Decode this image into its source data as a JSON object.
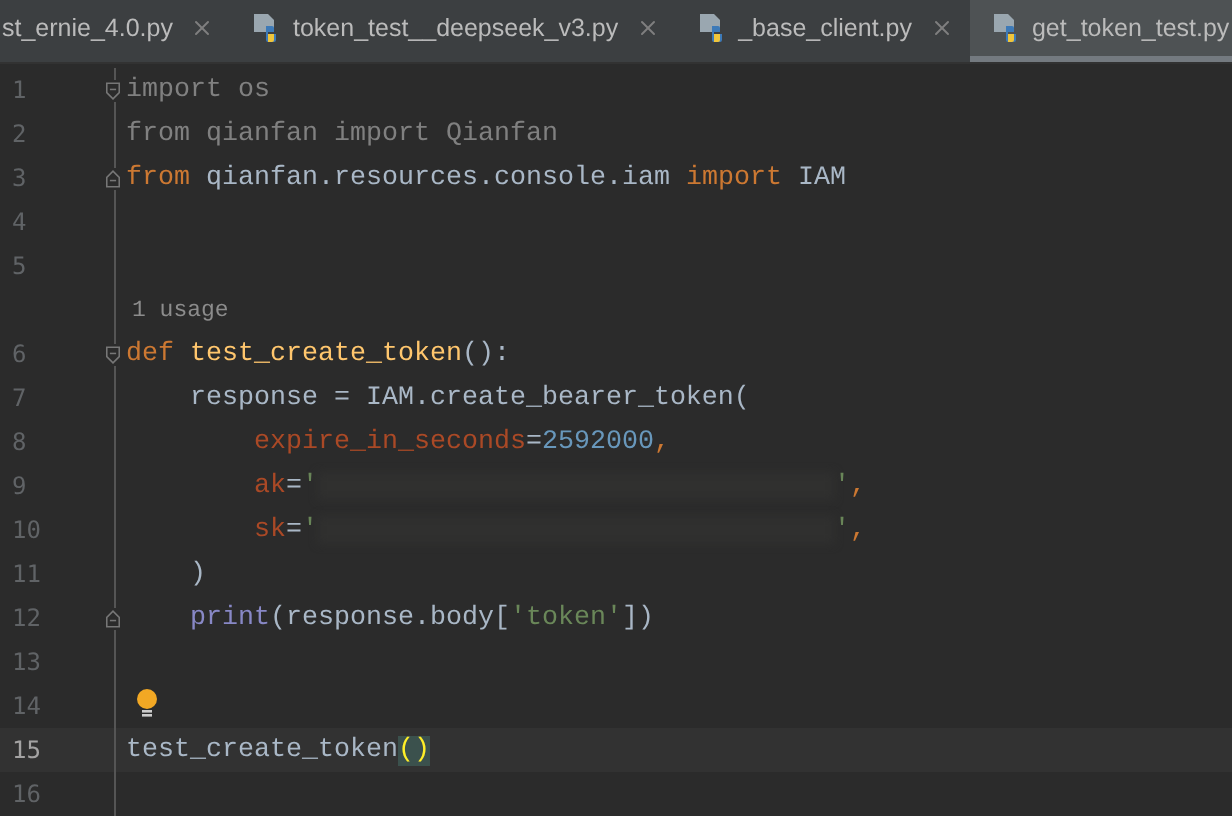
{
  "tabs": [
    {
      "label": "st_ernie_4.0.py",
      "selected": false,
      "icon": false
    },
    {
      "label": "token_test__deepseek_v3.py",
      "selected": false,
      "icon": true
    },
    {
      "label": "_base_client.py",
      "selected": false,
      "icon": true
    },
    {
      "label": "get_token_test.py",
      "selected": true,
      "icon": true
    }
  ],
  "lines": [
    {
      "number": "1",
      "kind": "fold-start",
      "current": false,
      "tokens": [
        {
          "kind": "unused",
          "text": "import os"
        }
      ]
    },
    {
      "number": "2",
      "kind": "plain",
      "current": false,
      "tokens": [
        {
          "kind": "unused",
          "text": "from qianfan import Qianfan"
        }
      ]
    },
    {
      "number": "3",
      "kind": "fold-end",
      "current": false,
      "tokens": [
        {
          "kind": "keyword",
          "text": "from "
        },
        {
          "kind": "plain",
          "text": "qianfan.resources.console.iam "
        },
        {
          "kind": "keyword",
          "text": "import "
        },
        {
          "kind": "plain",
          "text": "IAM"
        }
      ]
    },
    {
      "number": "4",
      "kind": "plain",
      "current": false
    },
    {
      "number": "5",
      "kind": "plain",
      "current": false
    },
    {
      "kind": "hint",
      "hint": "1 usage"
    },
    {
      "number": "6",
      "kind": "fold-start",
      "current": false,
      "tokens": [
        {
          "kind": "keyword",
          "text": "def "
        },
        {
          "kind": "func",
          "text": "test_create_token"
        },
        {
          "kind": "plain",
          "text": "():"
        }
      ]
    },
    {
      "number": "7",
      "kind": "plain",
      "current": false,
      "tokens": [
        {
          "kind": "plain",
          "text": "    response = IAM.create_bearer_token("
        }
      ]
    },
    {
      "number": "8",
      "kind": "plain",
      "current": false,
      "tokens": [
        {
          "kind": "param",
          "text": "        expire_in_seconds"
        },
        {
          "kind": "plain",
          "text": "="
        },
        {
          "kind": "number",
          "text": "2592000"
        },
        {
          "kind": "keyword",
          "text": ","
        }
      ]
    },
    {
      "number": "9",
      "kind": "plain",
      "current": false,
      "tokens": [
        {
          "kind": "param",
          "text": "        ak"
        },
        {
          "kind": "plain",
          "text": "="
        },
        {
          "kind": "string",
          "text": "'"
        },
        {
          "kind": "redacted"
        },
        {
          "kind": "string",
          "text": "'"
        },
        {
          "kind": "keyword",
          "text": ","
        }
      ]
    },
    {
      "number": "10",
      "kind": "plain",
      "current": false,
      "tokens": [
        {
          "kind": "param",
          "text": "        sk"
        },
        {
          "kind": "plain",
          "text": "="
        },
        {
          "kind": "string",
          "text": "'"
        },
        {
          "kind": "redacted"
        },
        {
          "kind": "string",
          "text": "'"
        },
        {
          "kind": "keyword",
          "text": ","
        }
      ]
    },
    {
      "number": "11",
      "kind": "plain",
      "current": false,
      "tokens": [
        {
          "kind": "plain",
          "text": "    )"
        }
      ]
    },
    {
      "number": "12",
      "kind": "fold-end",
      "current": false,
      "tokens": [
        {
          "kind": "builtin",
          "text": "    print"
        },
        {
          "kind": "plain",
          "text": "(response.body["
        },
        {
          "kind": "string",
          "text": "'token'"
        },
        {
          "kind": "plain",
          "text": "])"
        }
      ]
    },
    {
      "number": "13",
      "kind": "plain",
      "current": false
    },
    {
      "number": "14",
      "kind": "plain",
      "current": false,
      "bulb": true
    },
    {
      "number": "15",
      "kind": "plain",
      "current": true,
      "tokens": [
        {
          "kind": "plain",
          "text": "test_create_token"
        },
        {
          "kind": "match",
          "text": "()"
        }
      ]
    },
    {
      "number": "16",
      "kind": "plain",
      "current": false
    }
  ]
}
